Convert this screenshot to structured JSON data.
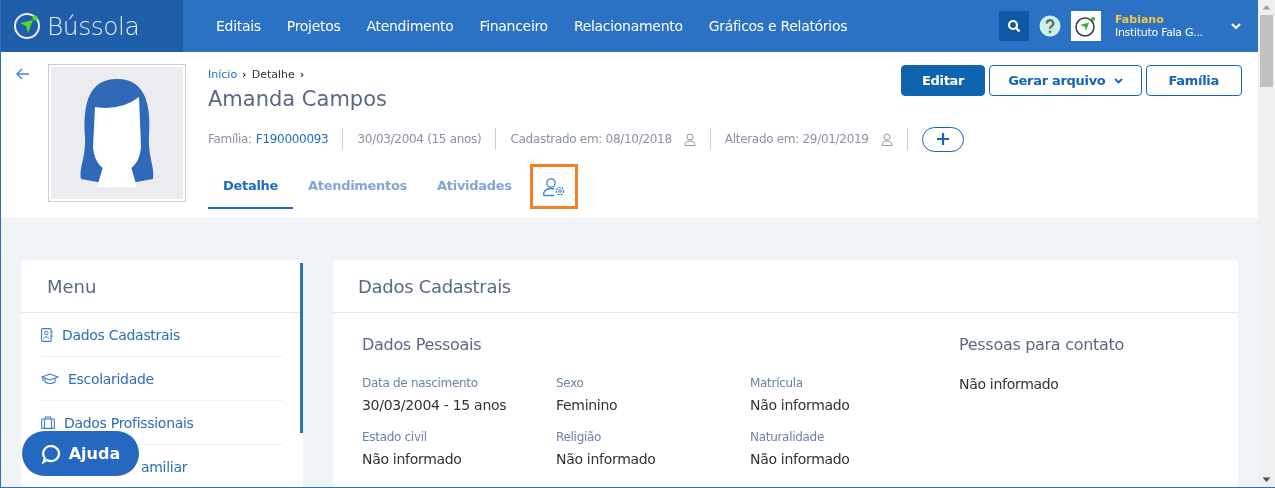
{
  "header": {
    "logo": "Bússola",
    "nav": [
      "Editais",
      "Projetos",
      "Atendimento",
      "Financeiro",
      "Relacionamento",
      "Gráficos e Relatórios"
    ],
    "user": {
      "name": "Fabiano",
      "org": "Instituto Fala G..."
    }
  },
  "profile": {
    "breadcrumb": [
      "Início",
      "›",
      "Detalhe",
      "›"
    ],
    "name": "Amanda Campos",
    "meta": [
      {
        "kind": "family",
        "label": "Família:",
        "value": "F190000093"
      },
      {
        "kind": "plain",
        "label": "30/03/2004 (15 anos)"
      },
      {
        "kind": "user",
        "label": "Cadastrado em: 08/10/2018"
      },
      {
        "kind": "user",
        "label": "Alterado em: 29/01/2019"
      }
    ],
    "actions": [
      {
        "label": "Editar",
        "kind": "primary"
      },
      {
        "label": "Gerar arquivo",
        "kind": "dropdown"
      },
      {
        "label": "Família",
        "kind": "outline"
      }
    ],
    "tabs": [
      {
        "label": "Detalhe",
        "selected": true
      },
      {
        "label": "Atendimentos",
        "selected": false
      },
      {
        "label": "Atividades",
        "selected": false
      },
      {
        "kind": "settings",
        "selected": false,
        "highlighted": true
      }
    ]
  },
  "menu": {
    "title": "Menu",
    "items": [
      {
        "label": "Dados Cadastrais",
        "kind": "contact"
      },
      {
        "label": "Escolaridade",
        "kind": "education"
      },
      {
        "label": "Dados Profissionais",
        "kind": "work"
      },
      {
        "label": "amiliar",
        "kind": "covered"
      }
    ]
  },
  "help_button": "Ajuda",
  "card": {
    "title": "Dados Cadastrais",
    "section": "Dados Pessoais",
    "fields": [
      {
        "label": "Data de nascimento",
        "value": "30/03/2004 - 15 anos"
      },
      {
        "label": "Sexo",
        "value": "Feminino"
      },
      {
        "label": "Matrícula",
        "value": "Não informado"
      },
      {
        "label": "Estado civil",
        "value": "Não informado"
      },
      {
        "label": "Religião",
        "value": "Não informado"
      },
      {
        "label": "Naturalidade",
        "value": "Não informado"
      }
    ],
    "contacts": {
      "title": "Pessoas para contato",
      "value": "Não informado"
    }
  }
}
